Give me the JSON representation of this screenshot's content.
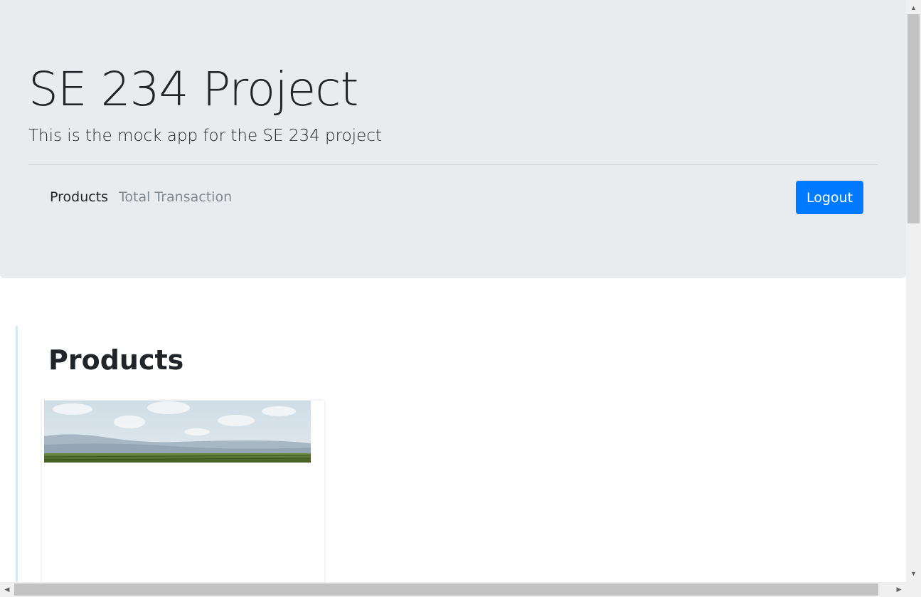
{
  "header": {
    "title": "SE 234 Project",
    "subtitle": "This is the mock app for the SE 234 project",
    "nav": [
      {
        "label": "Products",
        "active": true
      },
      {
        "label": "Total Transaction",
        "active": false
      }
    ],
    "logout_label": "Logout"
  },
  "products": {
    "heading": "Products",
    "items": [
      {
        "image_alt": "landscape-photo"
      }
    ]
  },
  "scrollbars": {
    "up_arrow": "▲",
    "down_arrow": "▼",
    "left_arrow": "◀",
    "right_arrow": "▶"
  },
  "colors": {
    "jumbotron_bg": "#e9ecef",
    "primary": "#007bff",
    "nav_muted": "#808890"
  }
}
